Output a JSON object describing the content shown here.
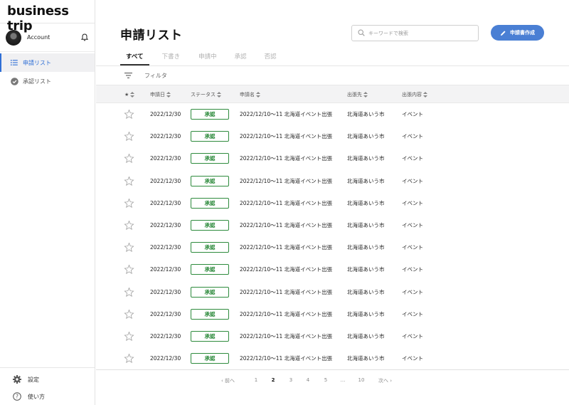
{
  "brand": "business trip",
  "account": {
    "name": "Account"
  },
  "sidebar": {
    "items": [
      {
        "label": "申請リスト",
        "icon": "list-icon",
        "active": true
      },
      {
        "label": "承認リスト",
        "icon": "check-circle-icon",
        "active": false
      }
    ],
    "bottom": [
      {
        "label": "設定",
        "icon": "gear-icon"
      },
      {
        "label": "使い方",
        "icon": "help-icon"
      }
    ]
  },
  "header": {
    "title": "申請リスト",
    "search_placeholder": "キーワードで検索",
    "create_label": "申請書作成"
  },
  "tabs": [
    "すべて",
    "下書き",
    "申請中",
    "承認",
    "否認"
  ],
  "filter_label": "フィルタ",
  "table": {
    "columns": [
      "★",
      "申請日",
      "ステータス",
      "申請名",
      "出張先",
      "出張内容"
    ],
    "rows": [
      {
        "date": "2022/12/30",
        "status": "承認",
        "name": "2022/12/10〜11 北海道イベント出張",
        "destination": "北海道あいう市",
        "content": "イベント"
      },
      {
        "date": "2022/12/30",
        "status": "承認",
        "name": "2022/12/10〜11 北海道イベント出張",
        "destination": "北海道あいう市",
        "content": "イベント"
      },
      {
        "date": "2022/12/30",
        "status": "承認",
        "name": "2022/12/10〜11 北海道イベント出張",
        "destination": "北海道あいう市",
        "content": "イベント"
      },
      {
        "date": "2022/12/30",
        "status": "承認",
        "name": "2022/12/10〜11 北海道イベント出張",
        "destination": "北海道あいう市",
        "content": "イベント"
      },
      {
        "date": "2022/12/30",
        "status": "承認",
        "name": "2022/12/10〜11 北海道イベント出張",
        "destination": "北海道あいう市",
        "content": "イベント"
      },
      {
        "date": "2022/12/30",
        "status": "承認",
        "name": "2022/12/10〜11 北海道イベント出張",
        "destination": "北海道あいう市",
        "content": "イベント"
      },
      {
        "date": "2022/12/30",
        "status": "承認",
        "name": "2022/12/10〜11 北海道イベント出張",
        "destination": "北海道あいう市",
        "content": "イベント"
      },
      {
        "date": "2022/12/30",
        "status": "承認",
        "name": "2022/12/10〜11 北海道イベント出張",
        "destination": "北海道あいう市",
        "content": "イベント"
      },
      {
        "date": "2022/12/30",
        "status": "承認",
        "name": "2022/12/10〜11 北海道イベント出張",
        "destination": "北海道あいう市",
        "content": "イベント"
      },
      {
        "date": "2022/12/30",
        "status": "承認",
        "name": "2022/12/10〜11 北海道イベント出張",
        "destination": "北海道あいう市",
        "content": "イベント"
      },
      {
        "date": "2022/12/30",
        "status": "承認",
        "name": "2022/12/10〜11 北海道イベント出張",
        "destination": "北海道あいう市",
        "content": "イベント"
      },
      {
        "date": "2022/12/30",
        "status": "承認",
        "name": "2022/12/10〜11 北海道イベント出張",
        "destination": "北海道あいう市",
        "content": "イベント"
      }
    ]
  },
  "pagination": {
    "prev": "‹ 前へ",
    "next": "次へ ›",
    "pages": [
      "1",
      "2",
      "3",
      "4",
      "5",
      "...",
      "10"
    ],
    "current": "2"
  },
  "colors": {
    "accent": "#4a7fd4",
    "approved": "#2e8b3d",
    "active_nav": "#2f6fd6"
  }
}
